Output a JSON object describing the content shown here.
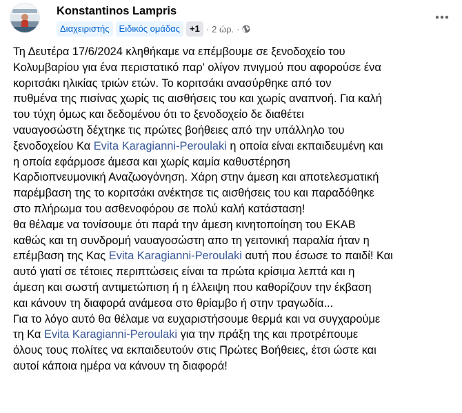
{
  "post": {
    "author": "Konstantinos Lampris",
    "badges": [
      "Διαχειριστής",
      "Ειδικός ομάδας"
    ],
    "badge_more": "+1",
    "separator": "·",
    "time": "2 ώρ.",
    "icons": {
      "privacy": "globe-icon",
      "menu": "more-options-icon"
    },
    "colors": {
      "mention": "#385898",
      "badge_bg": "#ebf5ff",
      "badge_text": "#0064d1"
    },
    "lines": [
      [
        "Τη Δευτέρα 17/6/2024 κληθήκαμε να επέμβουμε σε ξενοδοχείο του"
      ],
      [
        "Κολυμβαρίου για ένα περιστατικό παρ' ολίγον πνιγμού που αφορούσε ένα"
      ],
      [
        "κοριτσάκι ηλικίας τριών ετών. Το κοριτσάκι ανασύρθηκε από τον"
      ],
      [
        "πυθμένα της πισίνας χωρίς τις αισθήσεις του και χωρίς αναπνοή. Για καλή"
      ],
      [
        "του τύχη όμως και δεδομένου ότι το ξενοδοχείο δε διαθέτει"
      ],
      [
        "ναυαγοσώστη δέχτηκε τις πρώτες βοήθειες από την υπάλληλο του"
      ],
      [
        "ξενοδοχείου Κα ",
        "Evita Karagianni-Peroulaki",
        " η οποία είναι εκπαιδευμένη και"
      ],
      [
        "η οποία εφάρμοσε άμεσα και χωρίς καμία καθυστέρηση"
      ],
      [
        "Καρδιοπνευμονική Αναζωογόνηση. Χάρη στην άμεση  και αποτελεσματική"
      ],
      [
        "παρέμβαση της το κοριτσάκι ανέκτησε τις αισθήσεις του και παραδόθηκε"
      ],
      [
        "στο πλήρωμα του ασθενοφόρου σε πολύ καλή κατάσταση!"
      ],
      [
        "θα θέλαμε να τονίσουμε ότι παρά την άμεση κινητοποίηση του ΕΚΑΒ"
      ],
      [
        "καθώς και τη συνδρομή ναυαγοσώστη απο τη γειτονική παραλία ήταν η"
      ],
      [
        "επέμβαση της Κας ",
        "Evita Karagianni-Peroulaki",
        " αυτή που έσωσε το παιδί! Και"
      ],
      [
        "αυτό γιατί σε τέτοιες περιπτώσεις είναι τα πρώτα κρίσιμα λεπτά και η"
      ],
      [
        "άμεση και σωστή αντιμετώπιση ή η έλλειψη που καθορίζουν την έκβαση"
      ],
      [
        "και κάνουν τη διαφορά ανάμεσα στο θρίαμβο ή στην τραγωδία..."
      ],
      [
        "Για το λόγο αυτό θα θέλαμε να ευχαριστήσουμε θερμά και να συγχαρούμε"
      ],
      [
        "τη Κα ",
        "Evita Karagianni-Peroulaki",
        " για την πράξη της και προτρέπουμε"
      ],
      [
        "όλους τους πολίτες να εκπαιδευτούν στις Πρώτες Βοήθειες, έτσι ώστε και"
      ],
      [
        "αυτοί κάποια ημέρα να κάνουν τη διαφορά!"
      ]
    ]
  }
}
